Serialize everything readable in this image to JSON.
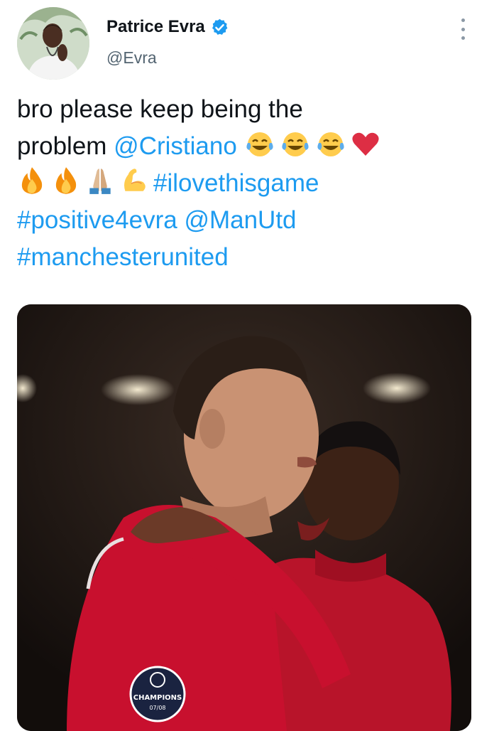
{
  "author": {
    "display_name": "Patrice Evra",
    "handle": "@Evra",
    "verified": true,
    "avatar_icon": "avatar-photo"
  },
  "menu": {
    "icon": "more-vertical-icon"
  },
  "tweet": {
    "line1": {
      "text": "bro please keep being the"
    },
    "line2": {
      "text": "problem ",
      "mention": "@Cristiano",
      "emojis": [
        "face-with-tears-of-joy-icon",
        "face-with-tears-of-joy-icon",
        "face-with-tears-of-joy-icon",
        "red-heart-icon"
      ]
    },
    "line3": {
      "emojis": [
        "fire-icon",
        "fire-icon",
        "folded-hands-icon",
        "flexed-biceps-icon"
      ],
      "hashtag": "#ilovethisgame"
    },
    "line4": {
      "hashtag": "#positive4evra",
      "mention": "@ManUtd"
    },
    "line5": {
      "hashtag": "#manchesterunited"
    }
  },
  "media": {
    "badge_line1": "CHAMPIONS",
    "badge_line2": "07/08"
  },
  "colors": {
    "link": "#1d9bf0",
    "verified": "#1d9bf0",
    "kit_red": "#c8102e"
  }
}
